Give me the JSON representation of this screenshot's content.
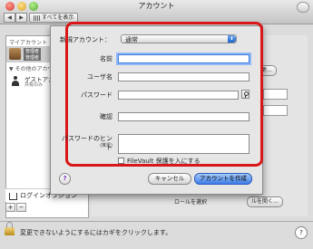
{
  "window": {
    "title": "アカウント",
    "nav_back": "◀",
    "nav_fwd": "▶",
    "show_all": "すべてを表示"
  },
  "sidebar": {
    "my_accounts_header": "マイアカウント",
    "current_user_badge": "管理者",
    "current_user_sub": "管理者",
    "other_accounts_header": "▼ その他のアカウント",
    "guest_name": "ゲストアカウ",
    "guest_sub": "共有のみ",
    "login_options": "ログインオプション",
    "add_button": "+",
    "remove_button": "−"
  },
  "background_main": {
    "change_button": "更...",
    "open_button": "ルを開く...",
    "login_label": "ロールを選択"
  },
  "bottom": {
    "lock_text": "変更できないようにするにはカギをクリックします。",
    "help": "?"
  },
  "sheet": {
    "new_account_label": "新規アカウント：",
    "new_account_value": "通常",
    "fields": {
      "name_label": "名前",
      "username_label": "ユーザ名",
      "password_label": "パスワード",
      "verify_label": "確認",
      "hint_label": "パスワードのヒント",
      "hint_sub": "(推奨)"
    },
    "filevault_label": "FileVault 保護を入にする",
    "cancel_button": "キャンセル",
    "create_button": "アカウントを作成",
    "help_button": "?"
  }
}
